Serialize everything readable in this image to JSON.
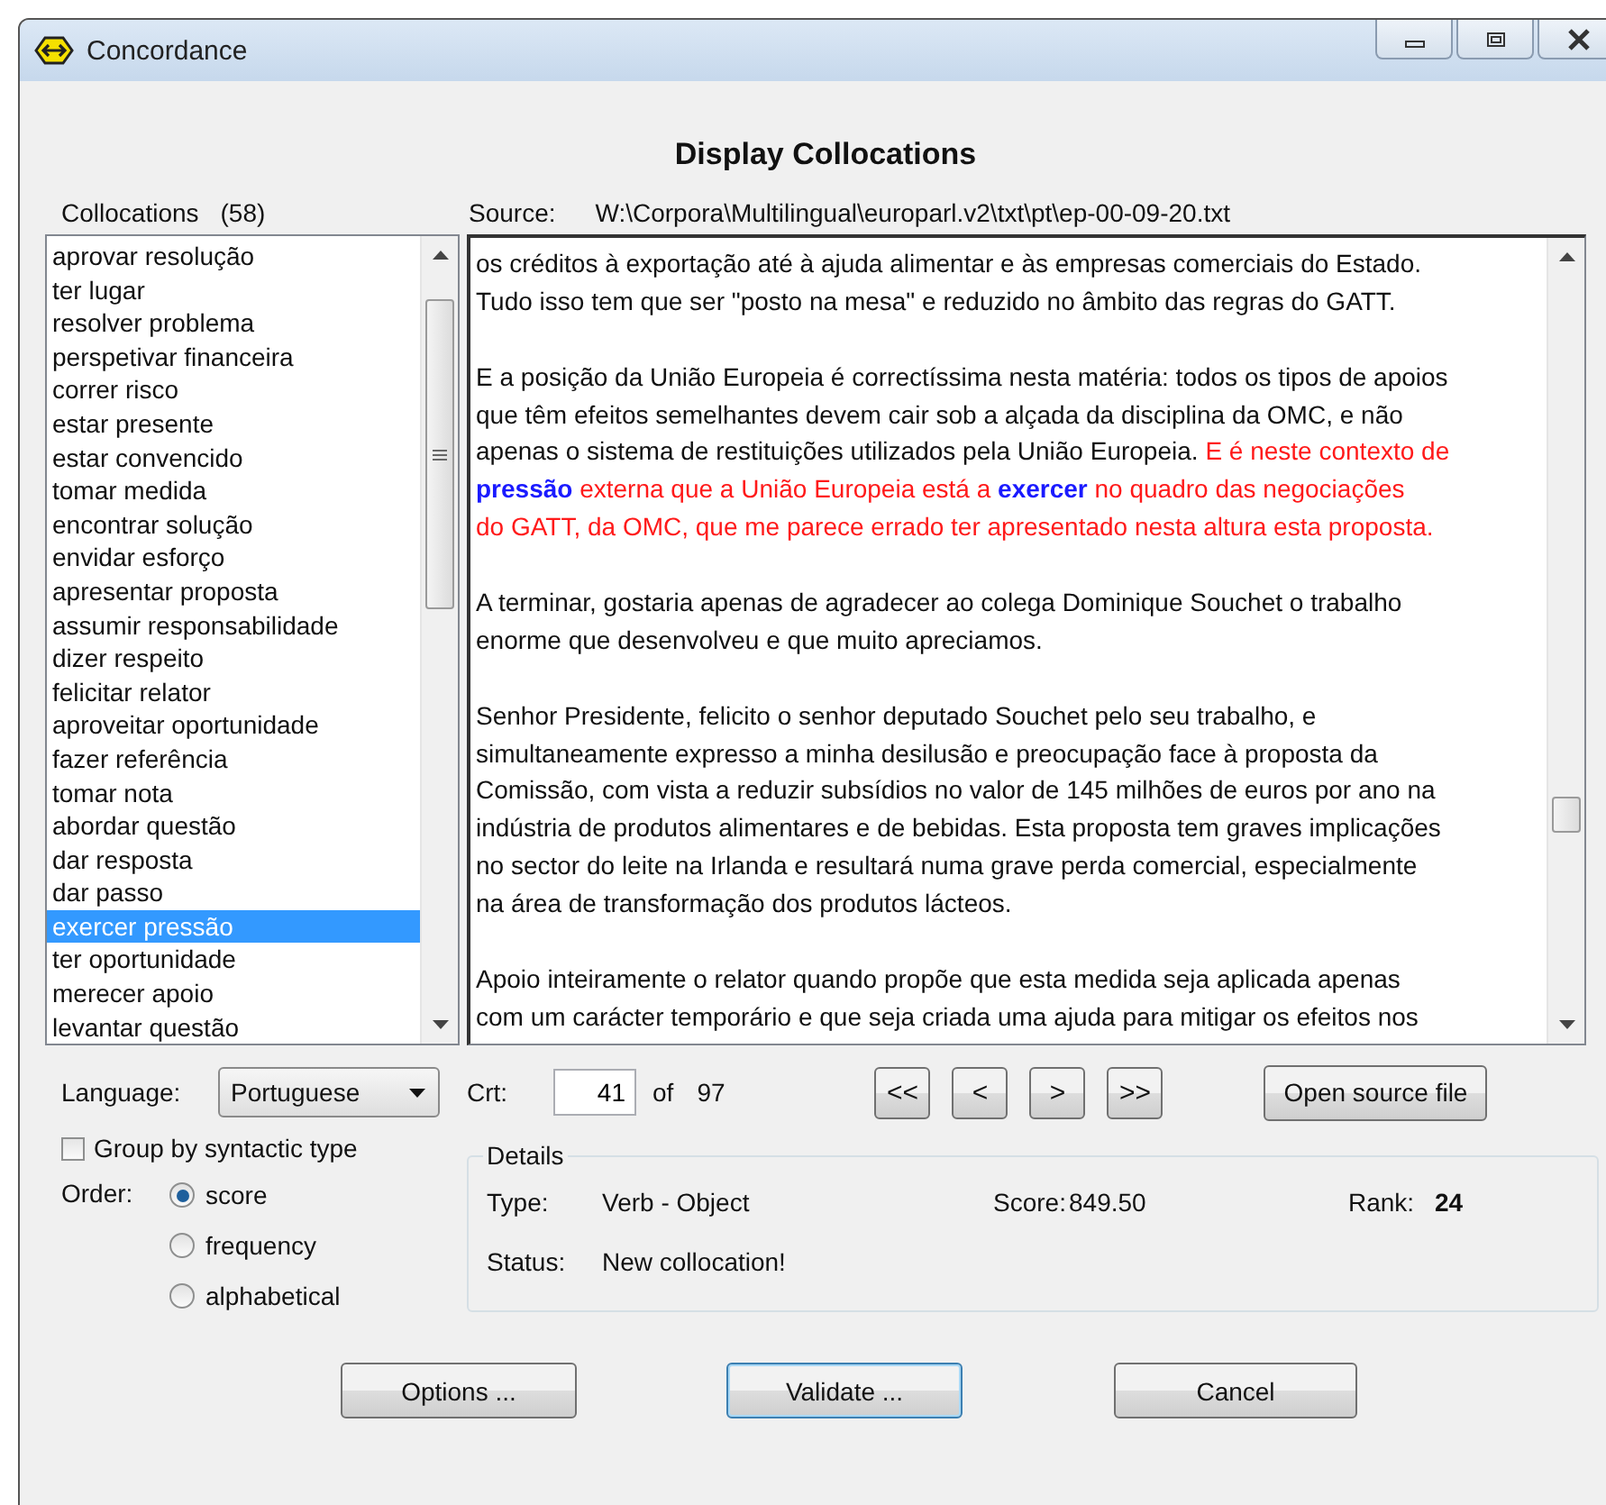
{
  "window": {
    "title": "Concordance"
  },
  "heading": "Display Collocations",
  "collocations": {
    "label": "Collocations",
    "count": "(58)",
    "items": [
      {
        "text": "aprovar resolução",
        "selected": false
      },
      {
        "text": "ter lugar",
        "selected": false
      },
      {
        "text": "resolver problema",
        "selected": false
      },
      {
        "text": "perspetivar financeira",
        "selected": false
      },
      {
        "text": "correr risco",
        "selected": false
      },
      {
        "text": "estar presente",
        "selected": false
      },
      {
        "text": "estar convencido",
        "selected": false
      },
      {
        "text": "tomar medida",
        "selected": false
      },
      {
        "text": "encontrar solução",
        "selected": false
      },
      {
        "text": "envidar esforço",
        "selected": false
      },
      {
        "text": "apresentar proposta",
        "selected": false
      },
      {
        "text": "assumir responsabilidade",
        "selected": false
      },
      {
        "text": "dizer respeito",
        "selected": false
      },
      {
        "text": "felicitar relator",
        "selected": false
      },
      {
        "text": "aproveitar oportunidade",
        "selected": false
      },
      {
        "text": "fazer referência",
        "selected": false
      },
      {
        "text": "tomar nota",
        "selected": false
      },
      {
        "text": "abordar questão",
        "selected": false
      },
      {
        "text": "dar resposta",
        "selected": false
      },
      {
        "text": "dar passo",
        "selected": false
      },
      {
        "text": "exercer pressão",
        "selected": true
      },
      {
        "text": "ter oportunidade",
        "selected": false
      },
      {
        "text": "merecer apoio",
        "selected": false
      },
      {
        "text": "levantar questão",
        "selected": false
      }
    ]
  },
  "source": {
    "label": "Source:",
    "path": "W:\\Corpora\\Multilingual\\europarl.v2\\txt\\pt\\ep-00-09-20.txt"
  },
  "text_pane": {
    "paragraphs": [
      {
        "lines": [
          [
            {
              "kind": "plain",
              "text": "os créditos à exportação até à ajuda alimentar e às empresas comerciais do Estado."
            }
          ],
          [
            {
              "kind": "plain",
              "text": "Tudo isso tem que ser \"posto na mesa\" e reduzido no âmbito das regras do GATT."
            }
          ]
        ]
      },
      {
        "lines": [
          [
            {
              "kind": "plain",
              "text": "E a posição da União Europeia é correctíssima nesta matéria: todos os tipos de apoios"
            }
          ],
          [
            {
              "kind": "plain",
              "text": "que têm efeitos semelhantes devem cair sob a alçada da disciplina da OMC, e não"
            }
          ],
          [
            {
              "kind": "plain",
              "text": "apenas o sistema de restituições utilizados pela União Europeia. "
            },
            {
              "kind": "context",
              "text": "E é neste contexto de"
            }
          ],
          [
            {
              "kind": "keyword",
              "text": "pressão"
            },
            {
              "kind": "context",
              "text": " externa que a União Europeia está a "
            },
            {
              "kind": "keyword",
              "text": "exercer"
            },
            {
              "kind": "context",
              "text": " no quadro das negociações"
            }
          ],
          [
            {
              "kind": "context",
              "text": "do GATT, da OMC, que me parece errado ter apresentado nesta altura esta proposta."
            }
          ]
        ]
      },
      {
        "lines": [
          [
            {
              "kind": "plain",
              "text": "A terminar, gostaria apenas de agradecer ao colega Dominique Souchet o trabalho"
            }
          ],
          [
            {
              "kind": "plain",
              "text": "enorme que desenvolveu e que muito apreciamos."
            }
          ]
        ]
      },
      {
        "lines": [
          [
            {
              "kind": "plain",
              "text": "Senhor Presidente, felicito o senhor deputado Souchet pelo seu trabalho, e"
            }
          ],
          [
            {
              "kind": "plain",
              "text": "simultaneamente expresso a minha desilusão e preocupação face à proposta da"
            }
          ],
          [
            {
              "kind": "plain",
              "text": "Comissão, com vista a reduzir subsídios no valor de 145 milhões de euros por ano na"
            }
          ],
          [
            {
              "kind": "plain",
              "text": "indústria de produtos alimentares e de bebidas. Esta proposta tem graves implicações"
            }
          ],
          [
            {
              "kind": "plain",
              "text": "no sector do leite na Irlanda e resultará numa grave perda comercial, especialmente"
            }
          ],
          [
            {
              "kind": "plain",
              "text": "na área de transformação dos produtos lácteos."
            }
          ]
        ]
      },
      {
        "lines": [
          [
            {
              "kind": "plain",
              "text": "Apoio inteiramente o relator quando propõe que esta medida seja aplicada apenas"
            }
          ],
          [
            {
              "kind": "plain",
              "text": "com um carácter temporário e que seja criada uma ajuda para mitigar os efeitos nos"
            }
          ]
        ]
      }
    ]
  },
  "language": {
    "label": "Language:",
    "value": "Portuguese"
  },
  "crt": {
    "label": "Crt:",
    "value": "41",
    "of_label": "of",
    "total": "97"
  },
  "nav_buttons": [
    "<<",
    "<",
    ">",
    ">>"
  ],
  "open_source_button": "Open source file",
  "group_by": {
    "label": "Group by syntactic type",
    "checked": false
  },
  "order": {
    "label": "Order:",
    "options": [
      {
        "label": "score",
        "selected": true
      },
      {
        "label": "frequency",
        "selected": false
      },
      {
        "label": "alphabetical",
        "selected": false
      }
    ]
  },
  "details": {
    "title": "Details",
    "type_label": "Type:",
    "type": "Verb - Object",
    "score_label": "Score:",
    "score": "849.50",
    "rank_label": "Rank:",
    "rank": "24",
    "status_label": "Status:",
    "status": "New collocation!"
  },
  "buttons": [
    {
      "label": "Options ...",
      "focused": false
    },
    {
      "label": "Validate ...",
      "focused": true
    },
    {
      "label": "Cancel",
      "focused": false
    }
  ]
}
